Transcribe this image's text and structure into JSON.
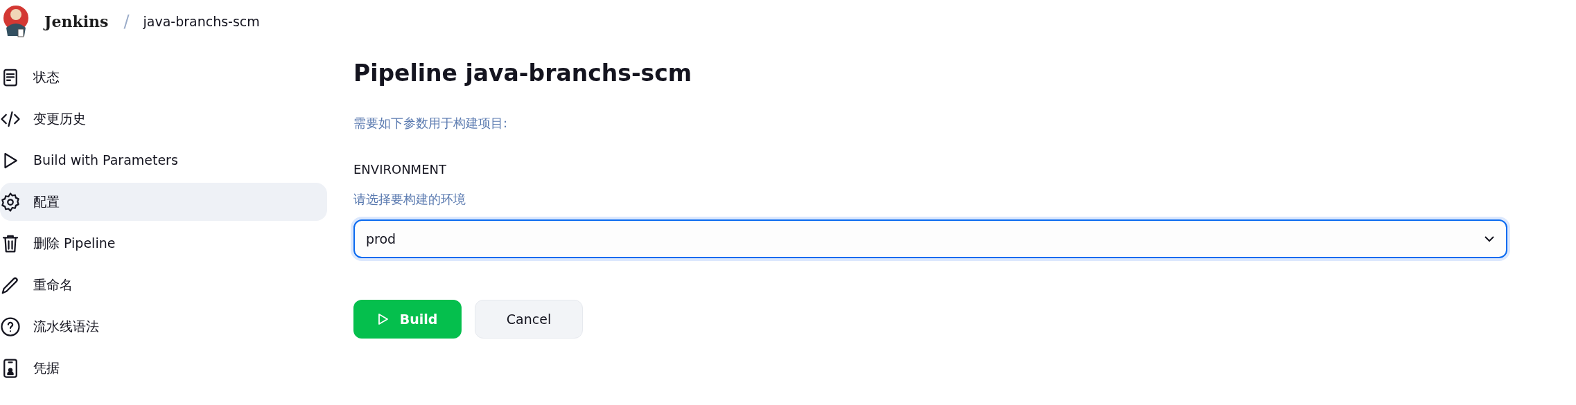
{
  "header": {
    "brand": "Jenkins",
    "separator": "/",
    "breadcrumb": "java-branchs-scm"
  },
  "sidebar": {
    "items": [
      {
        "kind": "document",
        "label": "状态",
        "highlighted": false
      },
      {
        "kind": "code",
        "label": "变更历史",
        "highlighted": false
      },
      {
        "kind": "play",
        "label": "Build with Parameters",
        "highlighted": false
      },
      {
        "kind": "gear",
        "label": "配置",
        "highlighted": true
      },
      {
        "kind": "trash",
        "label": "删除 Pipeline",
        "highlighted": false
      },
      {
        "kind": "pencil",
        "label": "重命名",
        "highlighted": false
      },
      {
        "kind": "help",
        "label": "流水线语法",
        "highlighted": false
      },
      {
        "kind": "badge",
        "label": "凭据",
        "highlighted": false
      }
    ]
  },
  "main": {
    "title": "Pipeline java-branchs-scm",
    "intro": "需要如下参数用于构建项目:",
    "parameter": {
      "name": "ENVIRONMENT",
      "description": "请选择要构建的环境",
      "value": "prod",
      "focused": true
    },
    "buttons": [
      {
        "kind": "primary",
        "label": "Build"
      },
      {
        "kind": "secondary",
        "label": "Cancel"
      }
    ]
  }
}
